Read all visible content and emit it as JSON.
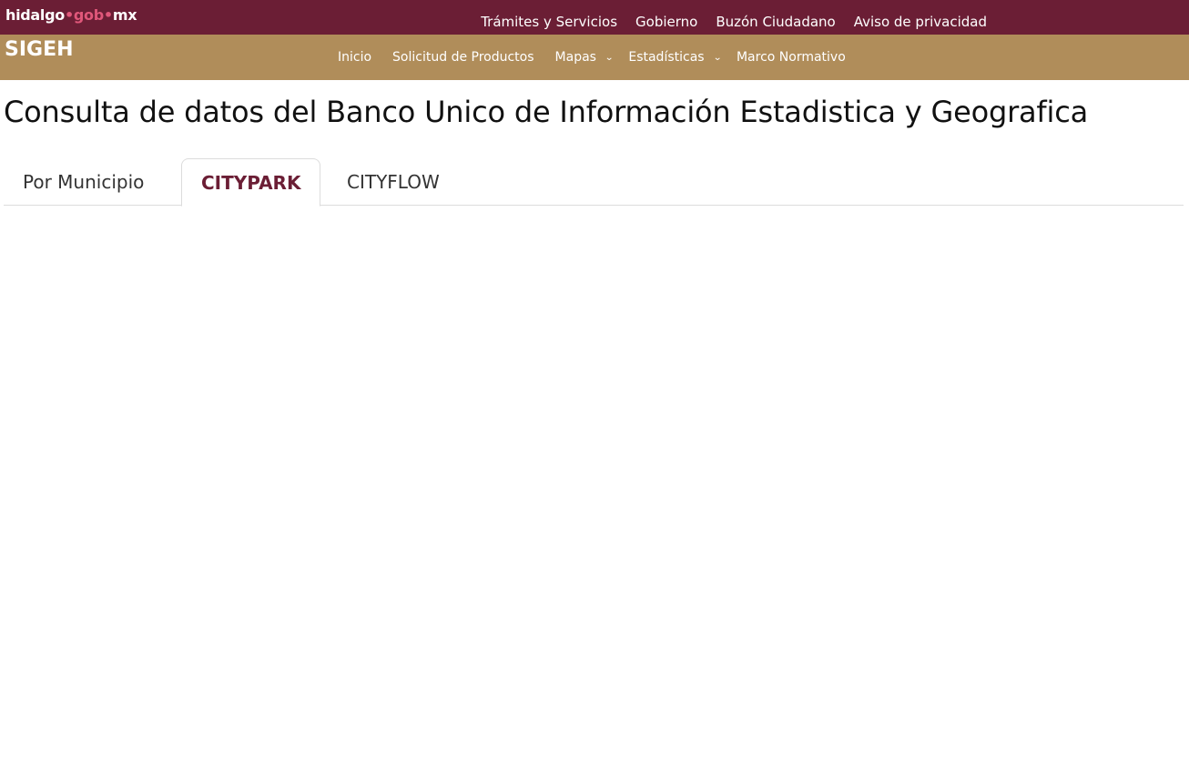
{
  "topbar": {
    "logo": {
      "part1": "hidalgo",
      "sep1": "•",
      "part2": "gob",
      "sep2": "•",
      "part3": "mx"
    },
    "links": [
      "Trámites y Servicios",
      "Gobierno",
      "Buzón Ciudadano",
      "Aviso de privacidad"
    ]
  },
  "navbar": {
    "brand": "SIGEH",
    "items": [
      {
        "label": "Inicio",
        "dropdown": false
      },
      {
        "label": "Solicitud de Productos",
        "dropdown": false
      },
      {
        "label": "Mapas",
        "dropdown": true
      },
      {
        "label": "Estadísticas",
        "dropdown": true
      },
      {
        "label": "Marco Normativo",
        "dropdown": false
      }
    ],
    "chevron": "⌄"
  },
  "page": {
    "title": "Consulta de datos del Banco Unico de Información Estadistica y Geografica"
  },
  "tabs": [
    {
      "label": "Por Municipio",
      "active": false
    },
    {
      "label": "CITYPARK",
      "active": true
    },
    {
      "label": "CITYFLOW",
      "active": false
    }
  ],
  "colors": {
    "topbar": "#6b1e35",
    "navbar": "#b08d5a",
    "accent": "#6b1e35",
    "logo_accent": "#e0577a"
  }
}
